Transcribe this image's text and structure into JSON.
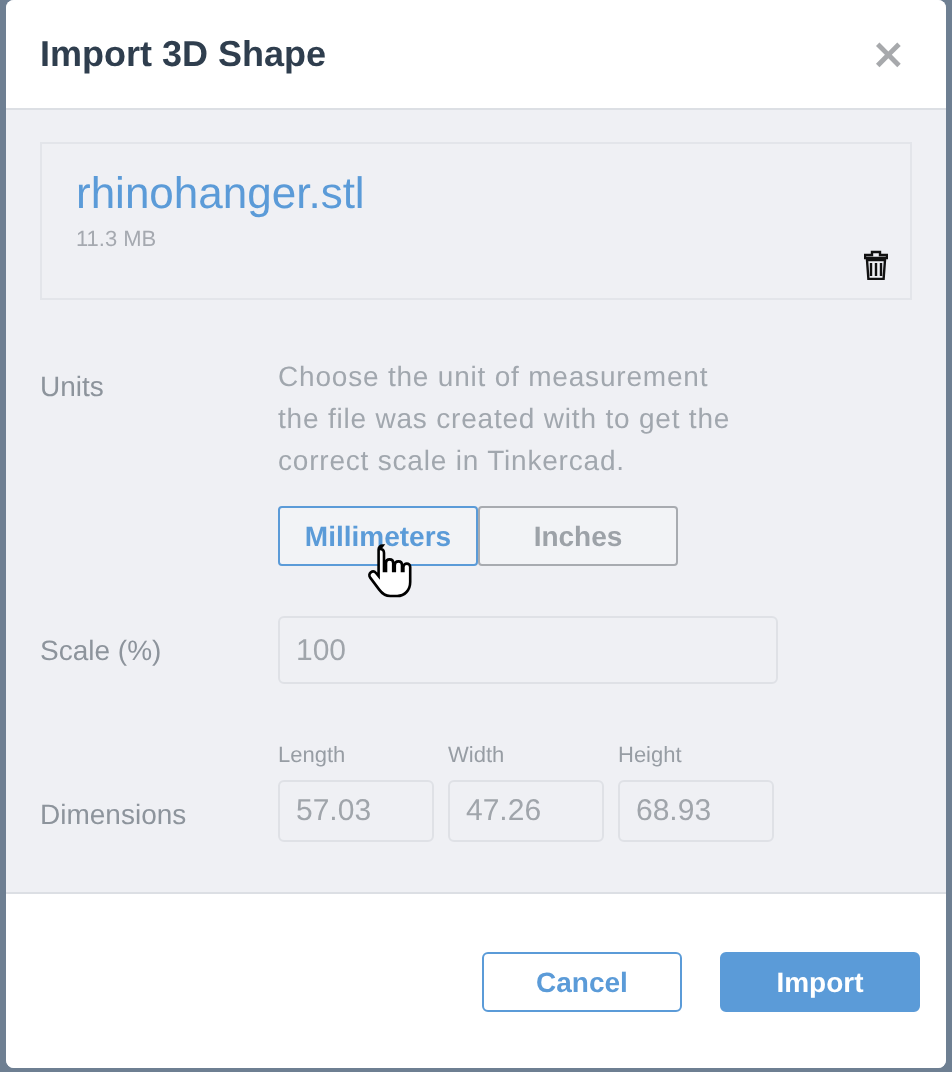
{
  "dialog": {
    "title": "Import 3D Shape",
    "close": "×"
  },
  "file": {
    "name": "rhinohanger.stl",
    "size": "11.3 MB"
  },
  "units": {
    "label": "Units",
    "description_lines": [
      "Choose the unit of measurement",
      "the file was created with to get the",
      "correct scale in Tinkercad."
    ],
    "options": [
      {
        "label": "Millimeters",
        "selected": true
      },
      {
        "label": "Inches",
        "selected": false
      }
    ]
  },
  "scale": {
    "label": "Scale (%)",
    "value": "100"
  },
  "dimensions": {
    "label": "Dimensions",
    "fields": [
      {
        "label": "Length",
        "value": "57.03"
      },
      {
        "label": "Width",
        "value": "47.26"
      },
      {
        "label": "Height",
        "value": "68.93"
      }
    ]
  },
  "buttons": [
    {
      "label": "Cancel",
      "kind": "secondary"
    },
    {
      "label": "Import",
      "kind": "primary"
    }
  ]
}
